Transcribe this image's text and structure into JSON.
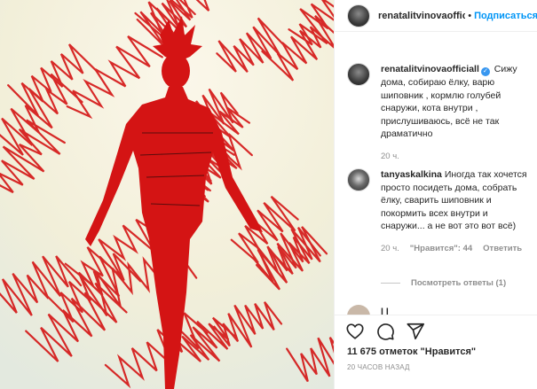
{
  "header": {
    "username": "renatalitvinovaofficiall",
    "separator": "•",
    "follow_label": "Подписаться"
  },
  "caption": {
    "username": "renatalitvinovaofficiall",
    "text": "Сижу дома, собираю ёлку, варю шиповник , кормлю голубей снаружи, кота внутри , прислушиваюсь, всё не так драматично",
    "time": "20 ч."
  },
  "comment": {
    "username": "tanyaskalkina",
    "text": "Иногда так хочется просто посидеть дома, собрать ёлку, сварить шиповник и покормить всех внутри и снаружи... а не вот это вот всё)",
    "time": "20 ч.",
    "likes": "\"Нравится\": 44",
    "reply": "Ответить",
    "view_replies": "Посмотреть ответы (1)"
  },
  "partial_comment": {
    "text": "l l"
  },
  "actions": {
    "likes_text": "11 675 отметок \"Нравится\"",
    "timestamp": "20 ЧАСОВ НАЗАД"
  },
  "icons": {
    "like": "heart-icon",
    "comment": "comment-icon",
    "share": "share-icon",
    "verified": "verified-icon"
  },
  "colors": {
    "accent": "#0095f6",
    "verified": "#3897f0",
    "muted": "#8e8e8e",
    "drawing_red": "#d41414"
  }
}
